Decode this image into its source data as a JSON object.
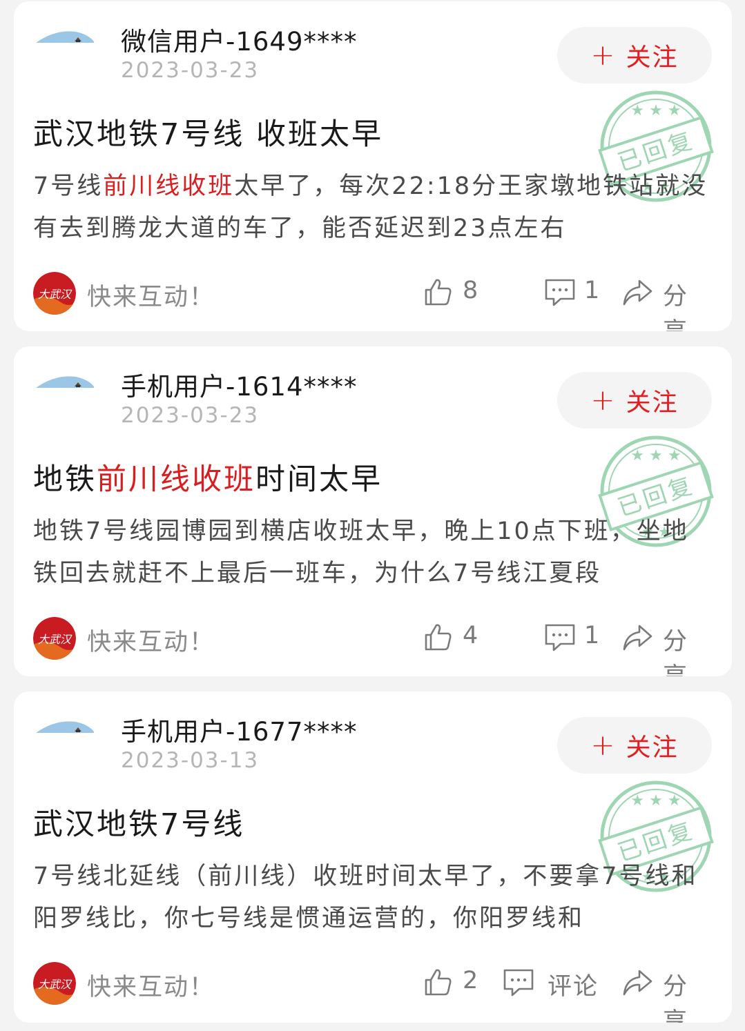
{
  "posts": [
    {
      "user": "微信用户-1649****",
      "date": "2023-03-23",
      "follow_label": "关注",
      "title_parts": [
        {
          "t": "武汉地铁7号线 收班太早",
          "hl": false
        }
      ],
      "body_parts": [
        {
          "t": "7号线",
          "hl": false
        },
        {
          "t": "前川线收班",
          "hl": true
        },
        {
          "t": "太早了，每次22:18分王家墩地铁站就没有去到腾龙大道的车了，能否延迟到23点左右",
          "hl": false
        }
      ],
      "stamp_text": "已回复",
      "prompt": "快来互动！",
      "logo_text": "大武汉",
      "likes": "8",
      "comments": "1",
      "share_label": "分享"
    },
    {
      "user": "手机用户-1614****",
      "date": "2023-03-23",
      "follow_label": "关注",
      "title_parts": [
        {
          "t": "地铁",
          "hl": false
        },
        {
          "t": "前川线收班",
          "hl": true
        },
        {
          "t": "时间太早",
          "hl": false
        }
      ],
      "body_parts": [
        {
          "t": "地铁7号线园博园到横店收班太早，晚上10点下班，坐地铁回去就赶不上最后一班车，为什么7号线江夏段",
          "hl": false
        }
      ],
      "stamp_text": "已回复",
      "prompt": "快来互动！",
      "logo_text": "大武汉",
      "likes": "4",
      "comments": "1",
      "share_label": "分享"
    },
    {
      "user": "手机用户-1677****",
      "date": "2023-03-13",
      "follow_label": "关注",
      "title_parts": [
        {
          "t": "武汉地铁7号线",
          "hl": false
        }
      ],
      "body_parts": [
        {
          "t": "7号线北延线（前川线）收班时间太早了，不要拿7号线和阳罗线比，你七号线是惯通运营的，你阳罗线和",
          "hl": false
        }
      ],
      "stamp_text": "已回复",
      "prompt": "快来互动！",
      "logo_text": "大武汉",
      "likes": "2",
      "comments": "评论",
      "share_label": "分享"
    }
  ],
  "colors": {
    "accent": "#d81e1e",
    "stamp": "#7ec89a",
    "muted": "#8a8a8a",
    "follow_bg": "#f4f4f4"
  }
}
